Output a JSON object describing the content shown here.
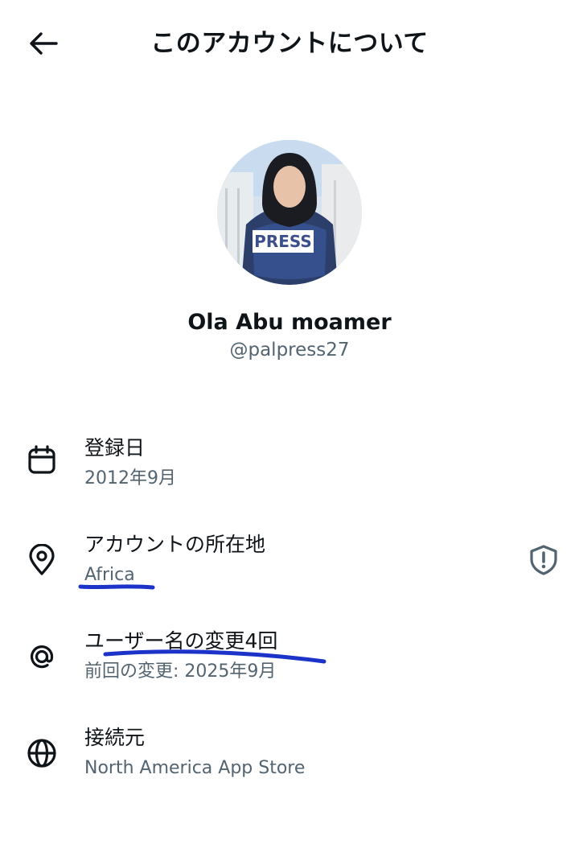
{
  "header": {
    "title": "このアカウントについて",
    "back_icon": "arrow-left-icon"
  },
  "profile": {
    "display_name": "Ola Abu moamer",
    "handle": "@palpress27",
    "avatar_badge_text": "PRESS"
  },
  "info": {
    "joined": {
      "icon": "calendar-icon",
      "label": "登録日",
      "value": "2012年9月"
    },
    "location": {
      "icon": "location-pin-icon",
      "label": "アカウントの所在地",
      "value": "Africa",
      "action_icon": "shield-alert-icon"
    },
    "username_changes": {
      "icon": "at-sign-icon",
      "label": "ユーザー名の変更4回",
      "value": "前回の変更: 2025年9月"
    },
    "connected_via": {
      "icon": "globe-icon",
      "label": "接続元",
      "value": "North America App Store"
    }
  },
  "colors": {
    "text_primary": "#0f1419",
    "text_secondary": "#536471",
    "annotation_ink": "#1b33c9"
  }
}
